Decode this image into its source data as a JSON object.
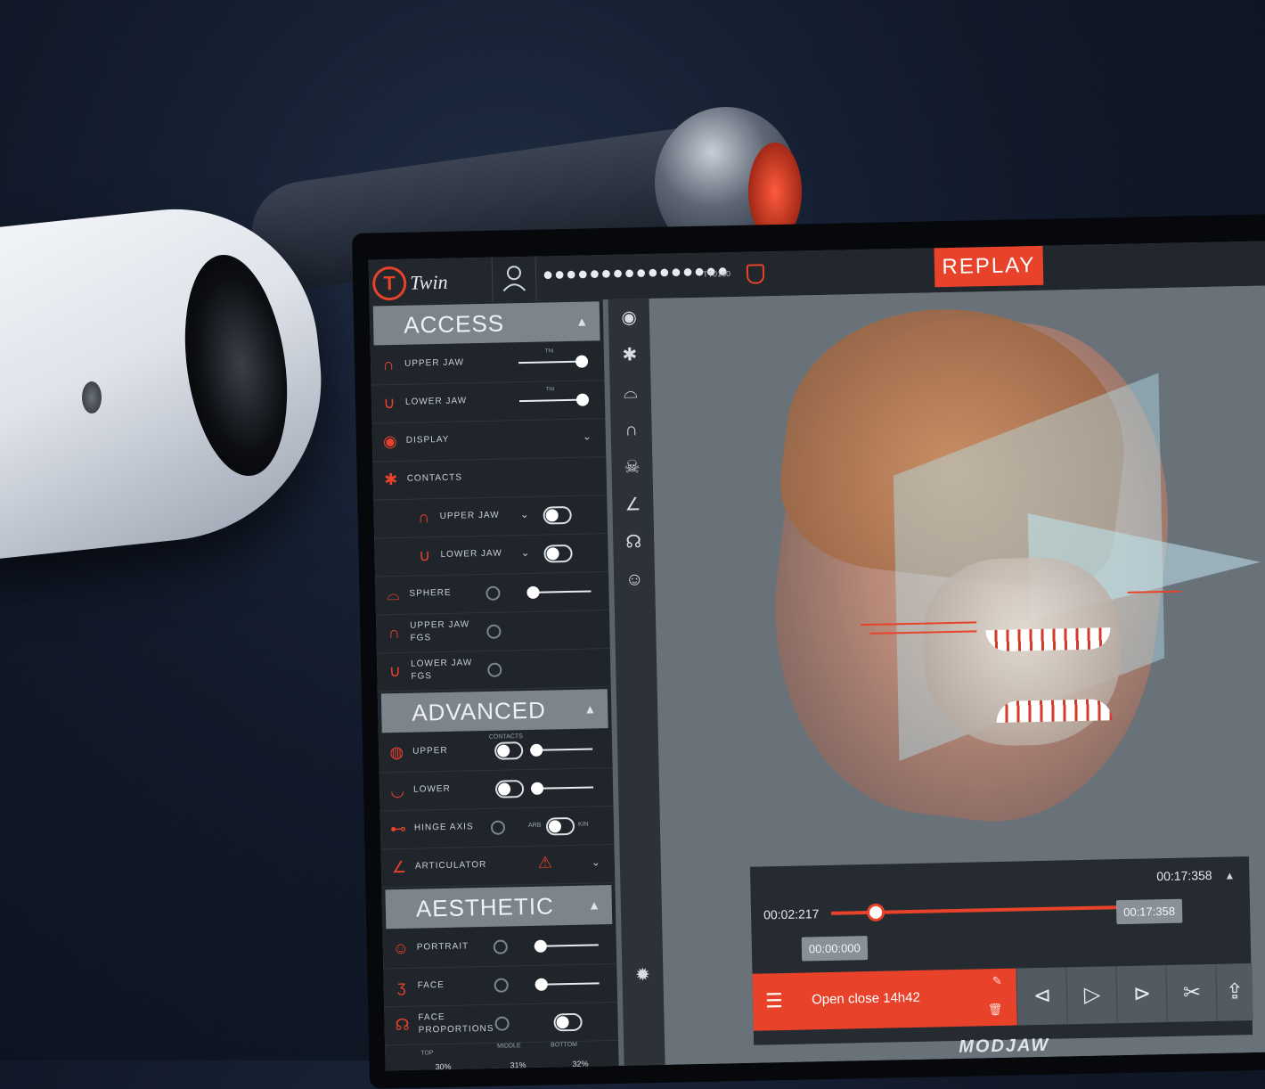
{
  "app": {
    "logo_letter": "T",
    "logo_text": "Twin",
    "replay_label": "REPLAY",
    "password_mask": "●●●●●●●●●●●●●●●●",
    "session_id": "TT0160",
    "brand": "MODJAW"
  },
  "access": {
    "title": "ACCESS",
    "upper_jaw": {
      "label": "UPPER JAW",
      "cap": "TNI",
      "value": 1.0
    },
    "lower_jaw": {
      "label": "LOWER JAW",
      "cap": "TNI",
      "value": 1.0
    },
    "display": "DISPLAY",
    "contacts": "CONTACTS",
    "contacts_upper": "UPPER JAW",
    "contacts_lower": "LOWER JAW",
    "sphere": {
      "label": "SPHERE",
      "value": 0.0
    },
    "upper_fgs": "UPPER JAW FGS",
    "lower_fgs": "LOWER JAW FGS"
  },
  "advanced": {
    "title": "ADVANCED",
    "contacts_cap": "CONTACTS",
    "upper": "UPPER",
    "lower": "LOWER",
    "hinge_axis": "HINGE AXIS",
    "arb": "ARB",
    "kin": "KIN",
    "articulator": "ARTICULATOR"
  },
  "aesthetic": {
    "title": "AESTHETIC",
    "portrait": "PORTRAIT",
    "face": "FACE",
    "face_proportions": "FACE PROPORTIONS",
    "top_label": "TOP",
    "top_value": "30%",
    "middle_label": "MIDDLE",
    "middle_value": "31%",
    "bottom_label": "BOTTOM",
    "bottom_value": "32%"
  },
  "timeline": {
    "current": "00:02:217",
    "end_top": "00:17:358",
    "end_chip": "00:17:358",
    "start_chip": "00:00:000",
    "clip_name": "Open close 14h42",
    "progress": 0.12
  },
  "icons": [
    "user-icon",
    "shield-icon",
    "eye-icon",
    "contacts-icon",
    "sphere-icon",
    "jaw-icon",
    "skull-icon",
    "angle-icon",
    "head-icon",
    "face-icon",
    "sun-icon",
    "menu-icon",
    "prev-frame-icon",
    "play-icon",
    "next-frame-icon",
    "cut-icon",
    "share-icon"
  ],
  "colors": {
    "accent": "#e8432a",
    "panel": "#20252b",
    "header": "#7d848c",
    "viewport": "#6a7279"
  }
}
